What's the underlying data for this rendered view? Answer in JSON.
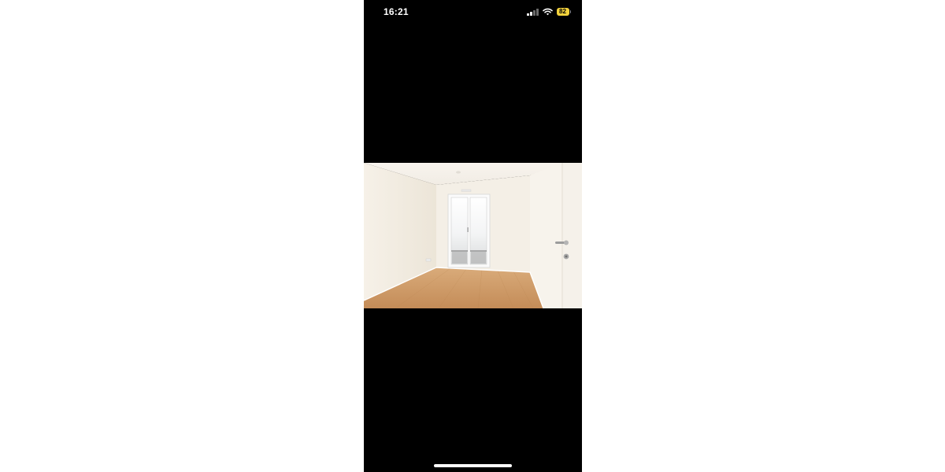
{
  "status_bar": {
    "time": "16:21",
    "battery_level": "82",
    "battery_color": "#f3d23c",
    "signal_bars_active": 2,
    "signal_bars_total": 4,
    "signal_icon": "cellular-signal-icon",
    "wifi_icon": "wifi-icon",
    "battery_icon": "battery-icon"
  },
  "viewer": {
    "background_color": "#000000",
    "photo_subject": "photo"
  },
  "home_indicator": {
    "color": "#ffffff"
  }
}
